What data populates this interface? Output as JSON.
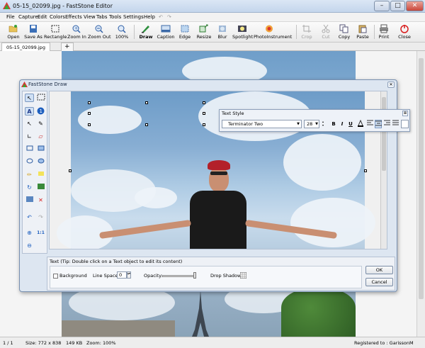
{
  "window": {
    "title": "05-15_02099.jpg - FastStone Editor",
    "min": "–",
    "max": "□",
    "close": "✕"
  },
  "menu": [
    "File",
    "Capture",
    "Edit",
    "Colors",
    "Effects",
    "View",
    "Tabs",
    "Tools",
    "Settings",
    "Help"
  ],
  "toolbar": [
    {
      "label": "Open",
      "icon": "open-folder-icon"
    },
    {
      "label": "Save As",
      "icon": "save-icon"
    },
    {
      "label": "Rectangle",
      "icon": "rectangle-select-icon"
    },
    {
      "label": "Zoom In",
      "icon": "zoom-in-icon"
    },
    {
      "label": "Zoom Out",
      "icon": "zoom-out-icon"
    },
    {
      "label": "100%",
      "icon": "zoom-100-icon"
    },
    {
      "label": "Draw",
      "icon": "draw-icon"
    },
    {
      "label": "Caption",
      "icon": "caption-icon"
    },
    {
      "label": "Edge",
      "icon": "edge-icon"
    },
    {
      "label": "Resize",
      "icon": "resize-icon"
    },
    {
      "label": "Blur",
      "icon": "blur-icon"
    },
    {
      "label": "Spotlight",
      "icon": "spotlight-icon"
    },
    {
      "label": "PhotoInstrument",
      "icon": "photoinstrument-icon"
    },
    {
      "label": "Crop",
      "icon": "crop-icon"
    },
    {
      "label": "Cut",
      "icon": "cut-icon"
    },
    {
      "label": "Copy",
      "icon": "copy-icon"
    },
    {
      "label": "Paste",
      "icon": "paste-icon"
    },
    {
      "label": "Print",
      "icon": "print-icon"
    },
    {
      "label": "Close",
      "icon": "power-icon"
    }
  ],
  "tabs": {
    "file": "05-15_02099.jpg",
    "new": "+"
  },
  "draw": {
    "title": "FastStone Draw",
    "tip": "Text (Tip: Double click on a Text object to edit its content)",
    "background_label": "Background",
    "linespace_label": "Line Space:",
    "linespace_value": "0",
    "opacity_label": "Opacity:",
    "dropshadow_label": "Drop Shadow:",
    "ok": "OK",
    "cancel": "Cancel"
  },
  "textstyle": {
    "title": "Text Style",
    "font": "Terminator Two",
    "size": "28",
    "bold": "B",
    "italic": "I",
    "underline": "U"
  },
  "status": {
    "page": "1 / 1",
    "size": "Size: 772 x 838",
    "filesize": "149 KB",
    "zoom": "Zoom: 100%",
    "registered": "Registered to : GarissonM"
  },
  "colors": {
    "accent": "#1e73be",
    "close_red": "#d81e1e"
  }
}
